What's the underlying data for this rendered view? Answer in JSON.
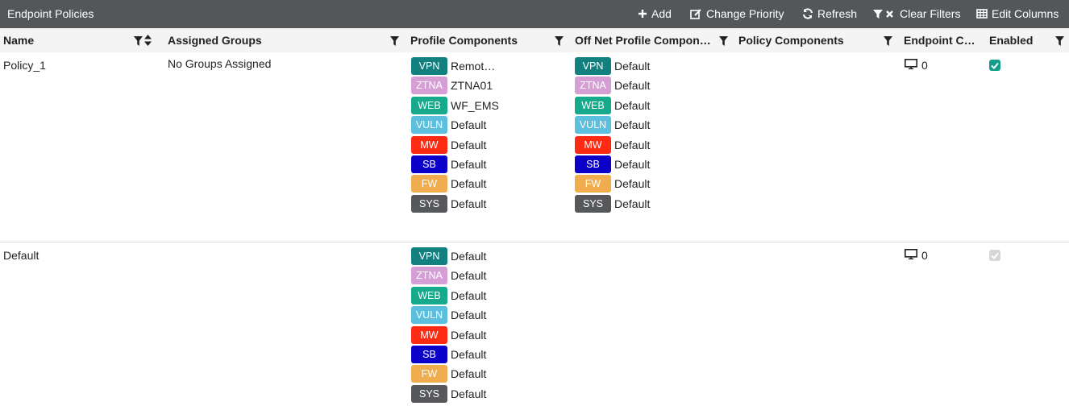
{
  "colors": {
    "topbar_bg": "#53575a",
    "header_bg": "#f4f4f4",
    "checkbox_on": "#139e8a",
    "checkbox_disabled": "#d6d6d6",
    "badges": {
      "VPN": "#138080",
      "ZTNA": "#d59fd6",
      "WEB": "#16a98c",
      "VULN": "#5cbfdd",
      "MW": "#ff2a12",
      "SB": "#0a00c8",
      "FW": "#f0ad4e",
      "SYS": "#56585b"
    }
  },
  "toolbar": {
    "title": "Endpoint Policies",
    "add_label": "Add",
    "change_priority_label": "Change Priority",
    "refresh_label": "Refresh",
    "clear_filters_label": "Clear Filters",
    "edit_columns_label": "Edit Columns"
  },
  "columns": {
    "name": "Name",
    "assigned_groups": "Assigned Groups",
    "profile_components": "Profile Components",
    "off_net": "Off Net Profile Compon…",
    "policy_components": "Policy Components",
    "endpoint_count": "Endpoint C…",
    "enabled": "Enabled"
  },
  "rows": [
    {
      "name": "Policy_1",
      "assigned_groups": "No Groups Assigned",
      "profile": [
        {
          "tag": "VPN",
          "value": "Remot…"
        },
        {
          "tag": "ZTNA",
          "value": "ZTNA01"
        },
        {
          "tag": "WEB",
          "value": "WF_EMS"
        },
        {
          "tag": "VULN",
          "value": "Default"
        },
        {
          "tag": "MW",
          "value": "Default"
        },
        {
          "tag": "SB",
          "value": "Default"
        },
        {
          "tag": "FW",
          "value": "Default"
        },
        {
          "tag": "SYS",
          "value": "Default"
        }
      ],
      "off_net": [
        {
          "tag": "VPN",
          "value": "Default"
        },
        {
          "tag": "ZTNA",
          "value": "Default"
        },
        {
          "tag": "WEB",
          "value": "Default"
        },
        {
          "tag": "VULN",
          "value": "Default"
        },
        {
          "tag": "MW",
          "value": "Default"
        },
        {
          "tag": "SB",
          "value": "Default"
        },
        {
          "tag": "FW",
          "value": "Default"
        },
        {
          "tag": "SYS",
          "value": "Default"
        }
      ],
      "endpoint_count": "0",
      "enabled": true
    },
    {
      "name": "Default",
      "assigned_groups": "",
      "profile": [
        {
          "tag": "VPN",
          "value": "Default"
        },
        {
          "tag": "ZTNA",
          "value": "Default"
        },
        {
          "tag": "WEB",
          "value": "Default"
        },
        {
          "tag": "VULN",
          "value": "Default"
        },
        {
          "tag": "MW",
          "value": "Default"
        },
        {
          "tag": "SB",
          "value": "Default"
        },
        {
          "tag": "FW",
          "value": "Default"
        },
        {
          "tag": "SYS",
          "value": "Default"
        }
      ],
      "off_net": [],
      "endpoint_count": "0",
      "enabled": true,
      "enabled_disabled": true
    }
  ]
}
